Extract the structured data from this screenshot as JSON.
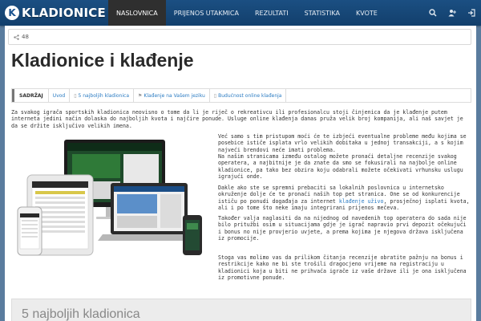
{
  "brand": {
    "logo_text": "KLADIONICE",
    "logo_letter": "K"
  },
  "nav": {
    "items": [
      {
        "label": "NASLOVNICA",
        "active": true
      },
      {
        "label": "PRIJENOS UTAKMICA",
        "active": false
      },
      {
        "label": "REZULTATI",
        "active": false
      },
      {
        "label": "STATISTIKA",
        "active": false
      },
      {
        "label": "KVOTE",
        "active": false
      }
    ],
    "icons": [
      "search-icon",
      "user-add-icon",
      "sign-in-icon"
    ]
  },
  "share": {
    "count": "48"
  },
  "page": {
    "title": "Kladionice i klađenje"
  },
  "toc": {
    "heading": "SADRŽAJ",
    "links": [
      "Uvod",
      "5 najboljih kladionica",
      "Klađenje na Vašem jeziku",
      "Budućnost online klađenja"
    ]
  },
  "content": {
    "intro": "Za svakog igrača sportskih kladionica neovisno o tome da li je riječ o rekreativcu ili profesionalcu stoji činjenica da je klađenje putem interneta jedini način dolaska do najboljih kvota i najčire ponude. Usluge online klađenja danas pruža velik broj kompanija, ali naš savjet je da se držite isključivo velikih imena.",
    "right1": "Već samo s tim pristupom moći će te izbjeći eventualne probleme među kojima se posebice ističe isplata vrlo velikih dobitaka u jednoj transakciji, a s kojim najveći brendovi neće imati problema.",
    "right2": "Na našim stranicama između ostalog možete pronaći detaljne recenzije svakog operatera, a najbitnije je da znate da smo se fokusirali na najbolje online kladionice, pa tako bez obzira koju odabrali možete očekivati vrhunsku uslugu igrajući onde.",
    "right3_a": "Dakle ako ste se spremni prebaciti sa lokalnih poslovnica u internetsko okruženje dolje će te pronaći naših top pet stranica. One se od konkurencije ističu po ponudi događaja za internet ",
    "right3_link": "klađenje uživo",
    "right3_b": ", prosječnoj isplati kvota, ali i po tome što neke imaju integrirani prijenos mečeva.",
    "right4": "Također valja naglasiti da na nijednog od navedenih top operatera do sada nije bilo pritužbi osim u situacijama gdje je igrač napravio prvi depozit očekujući i bonus no nije provjerio uvjete, a prema kojima je njegova država isključena iz promocije.",
    "bottom": "Stoga vas molimo vas da prilikom čitanja recenzije obratite pažnju na bonus i restrikcije kako ne bi ste trošili dragocjeno vrijeme na registraciju u kladionici koja u biti ne prihvaća igrače iz vaše države ili je ona isključena iz promotivne ponude."
  },
  "next_section": {
    "title": "5 najboljih kladionica"
  },
  "colors": {
    "nav_bg": "#1b4f82",
    "active_nav": "#2f2f2f",
    "link": "#2a7bc2",
    "page_bg": "#5a7c9e"
  }
}
